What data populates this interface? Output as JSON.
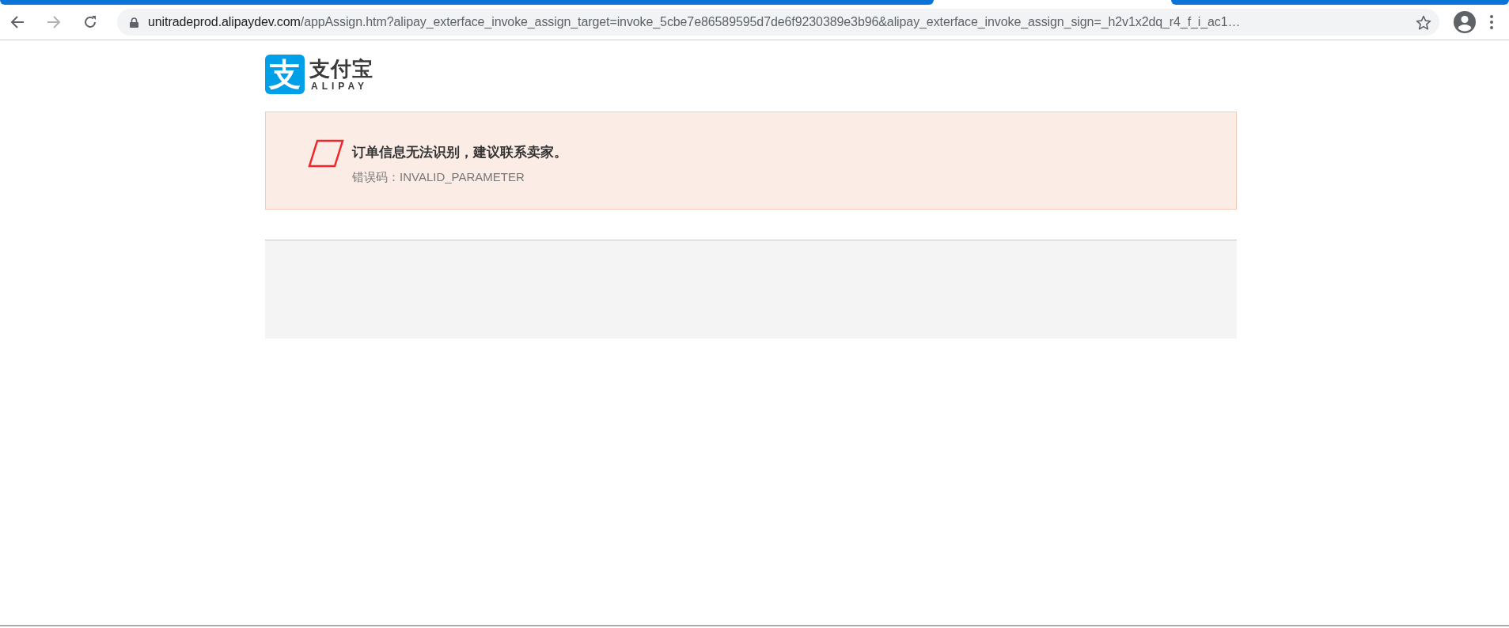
{
  "browser": {
    "url_host": "unitradeprod.alipaydev.com",
    "url_rest": "/appAssign.htm?alipay_exterface_invoke_assign_target=invoke_5cbe7e86589595d7de6f9230389e3b96&alipay_exterface_invoke_assign_sign=_h2v1x2dq_r4_f_i_ac1…"
  },
  "logo": {
    "glyph": "支",
    "name": "支付宝",
    "subtitle": "ALIPAY"
  },
  "error": {
    "message": "订单信息无法识别，建议联系卖家。",
    "code_label": "错误码：INVALID_PARAMETER"
  }
}
